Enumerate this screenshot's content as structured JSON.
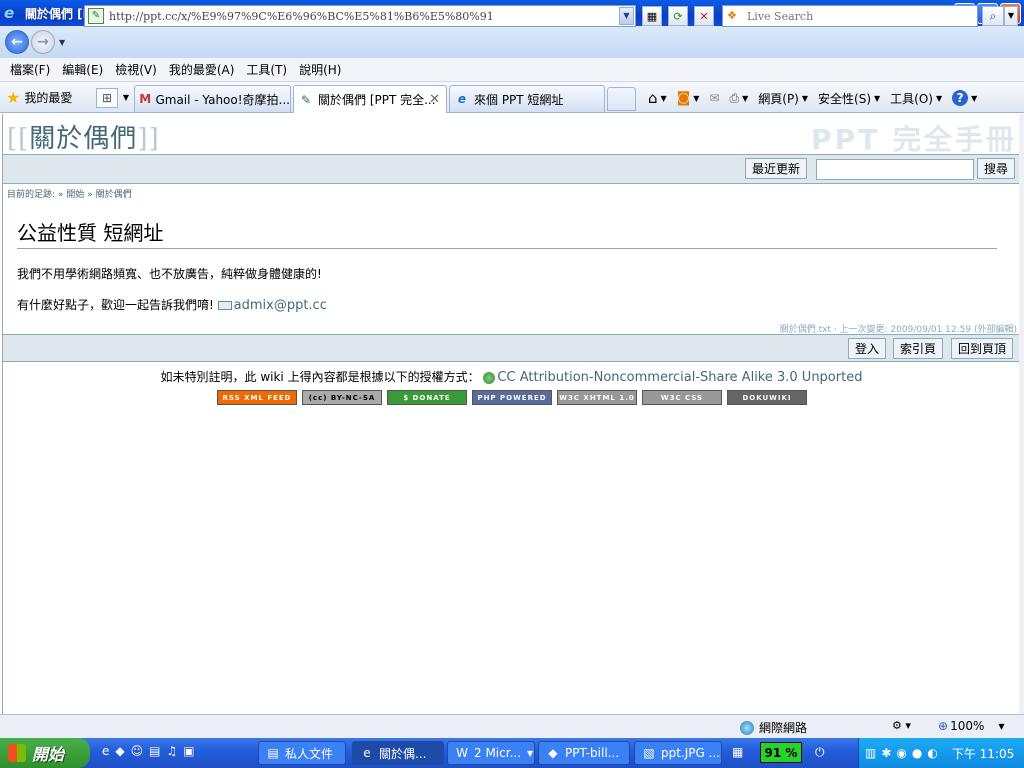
{
  "window": {
    "title": "關於偶們 [PPT 完全手冊] - Windows Internet Explorer",
    "minimize": "_",
    "maximize": "❐",
    "close": "✕"
  },
  "address": {
    "url": "http://ppt.cc/x/%E9%97%9C%E6%96%BC%E5%81%B6%E5%80%91",
    "search_placeholder": "Live Search"
  },
  "menu": [
    "檔案(F)",
    "編輯(E)",
    "檢視(V)",
    "我的最愛(A)",
    "工具(T)",
    "說明(H)"
  ],
  "favorites_label": "我的最愛",
  "tabs": [
    {
      "label": "Gmail - Yahoo!奇摩拍...",
      "icon": "M"
    },
    {
      "label": "關於偶們 [PPT 完全...",
      "icon": "✎",
      "active": true
    },
    {
      "label": "來個 PPT 短網址",
      "icon": "e"
    }
  ],
  "commands": {
    "page": "網頁(P)",
    "safety": "安全性(S)",
    "tools": "工具(O)"
  },
  "wiki": {
    "page_id": "關於偶們",
    "site_name": "PPT 完全手冊",
    "recent_button": "最近更新",
    "search_button": "搜尋",
    "breadcrumb_label": "目前的足跡:",
    "breadcrumb_sep": "»",
    "breadcrumb_items": [
      "開始",
      "關於偶們"
    ],
    "heading": "公益性質 短網址",
    "para1": "我們不用學術網路頻寬、也不放廣告，純粹做身體健康的!",
    "para2": "有什麼好點子，歡迎一起告訴我們唷!",
    "email": "admix@ppt.cc",
    "docinfo": "關於偶們.txt · 上一次變更: 2009/09/01 12:59 (外部編輯)",
    "login_button": "登入",
    "index_button": "索引頁",
    "top_button": "回到頁頂",
    "license_text": "如未特別註明，此 wiki 上得內容都是根據以下的授權方式：",
    "license_link": "CC Attribution-Noncommercial-Share Alike 3.0 Unported",
    "badges": [
      "RSS XML FEED",
      "(cc) BY-NC-SA",
      "$ DONATE",
      "PHP POWERED",
      "W3C XHTML 1.0",
      "W3C CSS",
      "DOKUWIKI"
    ]
  },
  "status": {
    "zone": "網際網路",
    "zoom": "100%"
  },
  "taskbar": {
    "start": "開始",
    "buttons": [
      "私人文件",
      "關於偶...",
      "2 Micr...",
      "PPT-bill...",
      "ppt.JPG ..."
    ],
    "battery": "91 %",
    "clock": "下午 11:05"
  }
}
